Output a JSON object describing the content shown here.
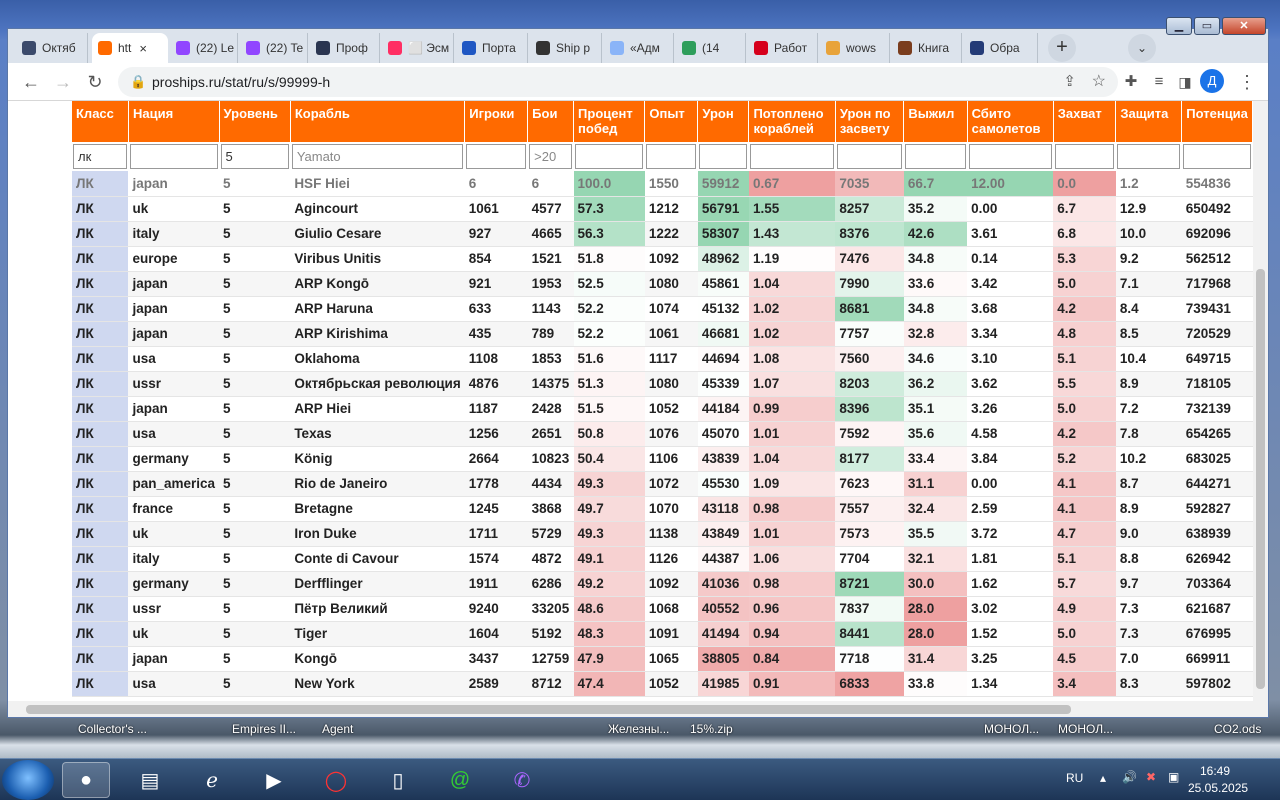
{
  "browser": {
    "tabs": [
      {
        "label": "Октяб",
        "color": "#3b4a6b"
      },
      {
        "label": "htt",
        "color": "#ff6a00",
        "active": true
      },
      {
        "label": "(22) Le",
        "color": "#9146ff"
      },
      {
        "label": "(22) Te",
        "color": "#9146ff"
      },
      {
        "label": "Проф",
        "color": "#2a3550"
      },
      {
        "label": "⬜ Эсм",
        "color": "#ff2e63"
      },
      {
        "label": "Порта",
        "color": "#1f57c3"
      },
      {
        "label": "Ship p",
        "color": "#333333"
      },
      {
        "label": "«Адм",
        "color": "#8ab4f8"
      },
      {
        "label": "(14",
        "color": "#2e9e5b"
      },
      {
        "label": "Работ",
        "color": "#d6001c"
      },
      {
        "label": "wows",
        "color": "#e8a33a"
      },
      {
        "label": "Книга",
        "color": "#7a3d1e"
      },
      {
        "label": "Обра",
        "color": "#243b77"
      }
    ],
    "url": "proships.ru/stat/ru/s/99999-h",
    "profile_letter": "Д",
    "tab_close": "×",
    "new_tab": "+",
    "tab_search": "⌄"
  },
  "table": {
    "headers": [
      "Класс",
      "Нация",
      "Уровень",
      "Корабль",
      "Игроки",
      "Бои",
      "Процент побед",
      "Опыт",
      "Урон",
      "Потоплено кораблей",
      "Урон по засвету",
      "Выжил",
      "Сбито самолетов",
      "Захват",
      "Защита",
      "Потенциа"
    ],
    "filters": [
      {
        "value": "лк",
        "placeholder": ""
      },
      {
        "value": "",
        "placeholder": ""
      },
      {
        "value": "5",
        "placeholder": ""
      },
      {
        "value": "",
        "placeholder": "Yamato"
      },
      {
        "value": "",
        "placeholder": ""
      },
      {
        "value": "",
        "placeholder": ">20"
      },
      {
        "value": "",
        "placeholder": ""
      },
      {
        "value": "",
        "placeholder": ""
      },
      {
        "value": "",
        "placeholder": ""
      },
      {
        "value": "",
        "placeholder": ""
      },
      {
        "value": "",
        "placeholder": ""
      },
      {
        "value": "",
        "placeholder": ""
      },
      {
        "value": "",
        "placeholder": ""
      },
      {
        "value": "",
        "placeholder": ""
      },
      {
        "value": "",
        "placeholder": ""
      },
      {
        "value": "",
        "placeholder": ""
      }
    ],
    "rows": [
      [
        "ЛК",
        "japan",
        "5",
        "HSF Hiei",
        "6",
        "6",
        "100.0",
        "1550",
        "59912",
        "0.67",
        "7035",
        "66.7",
        "12.00",
        "0.0",
        "1.2",
        "554836"
      ],
      [
        "ЛК",
        "uk",
        "5",
        "Agincourt",
        "1061",
        "4577",
        "57.3",
        "1212",
        "56791",
        "1.55",
        "8257",
        "35.2",
        "0.00",
        "6.7",
        "12.9",
        "650492"
      ],
      [
        "ЛК",
        "italy",
        "5",
        "Giulio Cesare",
        "927",
        "4665",
        "56.3",
        "1222",
        "58307",
        "1.43",
        "8376",
        "42.6",
        "3.61",
        "6.8",
        "10.0",
        "692096"
      ],
      [
        "ЛК",
        "europe",
        "5",
        "Viribus Unitis",
        "854",
        "1521",
        "51.8",
        "1092",
        "48962",
        "1.19",
        "7476",
        "34.8",
        "0.14",
        "5.3",
        "9.2",
        "562512"
      ],
      [
        "ЛК",
        "japan",
        "5",
        "ARP Kongō",
        "921",
        "1953",
        "52.5",
        "1080",
        "45861",
        "1.04",
        "7990",
        "33.6",
        "3.42",
        "5.0",
        "7.1",
        "717968"
      ],
      [
        "ЛК",
        "japan",
        "5",
        "ARP Haruna",
        "633",
        "1143",
        "52.2",
        "1074",
        "45132",
        "1.02",
        "8681",
        "34.8",
        "3.68",
        "4.2",
        "8.4",
        "739431"
      ],
      [
        "ЛК",
        "japan",
        "5",
        "ARP Kirishima",
        "435",
        "789",
        "52.2",
        "1061",
        "46681",
        "1.02",
        "7757",
        "32.8",
        "3.34",
        "4.8",
        "8.5",
        "720529"
      ],
      [
        "ЛК",
        "usa",
        "5",
        "Oklahoma",
        "1108",
        "1853",
        "51.6",
        "1117",
        "44694",
        "1.08",
        "7560",
        "34.6",
        "3.10",
        "5.1",
        "10.4",
        "649715"
      ],
      [
        "ЛК",
        "ussr",
        "5",
        "Октябрьская революция",
        "4876",
        "14375",
        "51.3",
        "1080",
        "45339",
        "1.07",
        "8203",
        "36.2",
        "3.62",
        "5.5",
        "8.9",
        "718105"
      ],
      [
        "ЛК",
        "japan",
        "5",
        "ARP Hiei",
        "1187",
        "2428",
        "51.5",
        "1052",
        "44184",
        "0.99",
        "8396",
        "35.1",
        "3.26",
        "5.0",
        "7.2",
        "732139"
      ],
      [
        "ЛК",
        "usa",
        "5",
        "Texas",
        "1256",
        "2651",
        "50.8",
        "1076",
        "45070",
        "1.01",
        "7592",
        "35.6",
        "4.58",
        "4.2",
        "7.8",
        "654265"
      ],
      [
        "ЛК",
        "germany",
        "5",
        "König",
        "2664",
        "10823",
        "50.4",
        "1106",
        "43839",
        "1.04",
        "8177",
        "33.4",
        "3.84",
        "5.2",
        "10.2",
        "683025"
      ],
      [
        "ЛК",
        "pan_america",
        "5",
        "Rio de Janeiro",
        "1778",
        "4434",
        "49.3",
        "1072",
        "45530",
        "1.09",
        "7623",
        "31.1",
        "0.00",
        "4.1",
        "8.7",
        "644271"
      ],
      [
        "ЛК",
        "france",
        "5",
        "Bretagne",
        "1245",
        "3868",
        "49.7",
        "1070",
        "43118",
        "0.98",
        "7557",
        "32.4",
        "2.59",
        "4.1",
        "8.9",
        "592827"
      ],
      [
        "ЛК",
        "uk",
        "5",
        "Iron Duke",
        "1711",
        "5729",
        "49.3",
        "1138",
        "43849",
        "1.01",
        "7573",
        "35.5",
        "3.72",
        "4.7",
        "9.0",
        "638939"
      ],
      [
        "ЛК",
        "italy",
        "5",
        "Conte di Cavour",
        "1574",
        "4872",
        "49.1",
        "1126",
        "44387",
        "1.06",
        "7704",
        "32.1",
        "1.81",
        "5.1",
        "8.8",
        "626942"
      ],
      [
        "ЛК",
        "germany",
        "5",
        "Derfflinger",
        "1911",
        "6286",
        "49.2",
        "1092",
        "41036",
        "0.98",
        "8721",
        "30.0",
        "1.62",
        "5.7",
        "9.7",
        "703364"
      ],
      [
        "ЛК",
        "ussr",
        "5",
        "Пётр Великий",
        "9240",
        "33205",
        "48.6",
        "1068",
        "40552",
        "0.96",
        "7837",
        "28.0",
        "3.02",
        "4.9",
        "7.3",
        "621687"
      ],
      [
        "ЛК",
        "uk",
        "5",
        "Tiger",
        "1604",
        "5192",
        "48.3",
        "1091",
        "41494",
        "0.94",
        "8441",
        "28.0",
        "1.52",
        "5.0",
        "7.3",
        "676995"
      ],
      [
        "ЛК",
        "japan",
        "5",
        "Kongō",
        "3437",
        "12759",
        "47.9",
        "1065",
        "38805",
        "0.84",
        "7718",
        "31.4",
        "3.25",
        "4.5",
        "7.0",
        "669911"
      ],
      [
        "ЛК",
        "usa",
        "5",
        "New York",
        "2589",
        "8712",
        "47.4",
        "1052",
        "41985",
        "0.91",
        "6833",
        "33.8",
        "1.34",
        "3.4",
        "8.3",
        "597802"
      ]
    ]
  },
  "taskbar": {
    "lang": "RU",
    "time": "16:49",
    "date": "25.05.2025",
    "desktop_labels": [
      "Collector's ...",
      "Empires II...",
      "Agent",
      "Железны...",
      "15%.zip",
      "МОНОЛ...",
      "МОНОЛ...",
      "CO2.ods"
    ]
  }
}
